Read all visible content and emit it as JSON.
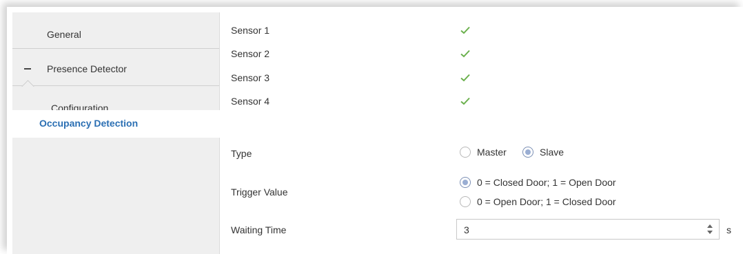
{
  "sidebar": {
    "items": [
      {
        "label": "General"
      },
      {
        "label": "Presence Detector"
      },
      {
        "label": "Configuration"
      },
      {
        "label": "Occupancy Detection"
      }
    ]
  },
  "sensors": [
    {
      "label": "Sensor 1",
      "checked": true
    },
    {
      "label": "Sensor 2",
      "checked": true
    },
    {
      "label": "Sensor 3",
      "checked": true
    },
    {
      "label": "Sensor 4",
      "checked": true
    }
  ],
  "type": {
    "label": "Type",
    "options": [
      "Master",
      "Slave"
    ],
    "selected": "Slave"
  },
  "trigger": {
    "label": "Trigger Value",
    "options": [
      "0 = Closed Door; 1 = Open Door",
      "0 = Open Door; 1 = Closed Door"
    ],
    "selected": "0 = Closed Door; 1 = Open Door"
  },
  "waiting": {
    "label": "Waiting Time",
    "value": "3",
    "unit": "s"
  },
  "colors": {
    "accent": "#2b6fb3",
    "check": "#6ab04c",
    "sidebar_bg": "#efefef"
  }
}
